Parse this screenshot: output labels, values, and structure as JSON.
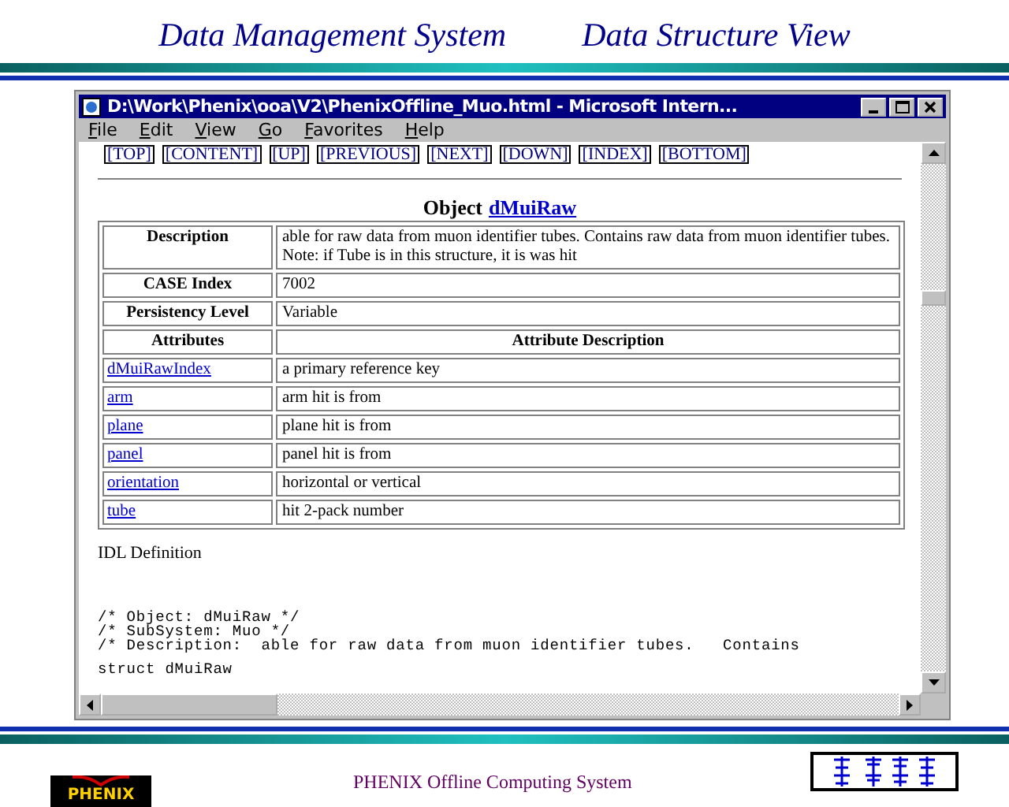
{
  "header": {
    "left_title": "Data Management System",
    "right_title": "Data Structure View"
  },
  "window": {
    "title": "D:\\Work\\Phenix\\ooa\\V2\\PhenixOffline_Muo.html - Microsoft Intern...",
    "menu": [
      "File",
      "Edit",
      "View",
      "Go",
      "Favorites",
      "Help"
    ],
    "nav_links": [
      "[TOP]",
      "[CONTENT]",
      "[UP]",
      "[PREVIOUS]",
      "[NEXT]",
      "[DOWN]",
      "[INDEX]",
      "[BOTTOM]"
    ],
    "object_heading": {
      "label": "Object",
      "name": "dMuiRaw"
    },
    "info_rows": [
      {
        "label": "Description",
        "value": "able for raw data from muon identifier tubes. Contains raw data from muon identifier tubes. Note: if Tube is in this structure, it is was hit"
      },
      {
        "label": "CASE Index",
        "value": "7002"
      },
      {
        "label": "Persistency Level",
        "value": "Variable"
      }
    ],
    "attribute_columns": [
      "Attributes",
      "Attribute Description"
    ],
    "attributes": [
      {
        "name": "dMuiRawIndex",
        "description": "a primary reference key"
      },
      {
        "name": "arm",
        "description": "arm hit is from"
      },
      {
        "name": "plane",
        "description": "plane hit is from"
      },
      {
        "name": "panel",
        "description": "panel hit is from"
      },
      {
        "name": "orientation",
        "description": "horizontal or vertical"
      },
      {
        "name": "tube",
        "description": "hit 2-pack number"
      }
    ],
    "idl_heading": "IDL Definition",
    "code_lines": [
      "/* Object: dMuiRaw */",
      "/* SubSystem: Muo */",
      "/* Description:  able for raw data from muon identifier tubes.   Contains"
    ],
    "code_tail": "struct dMuiRaw"
  },
  "footer": {
    "logo_text": "PHENIX",
    "caption": "PHENIX Offline Computing System"
  }
}
